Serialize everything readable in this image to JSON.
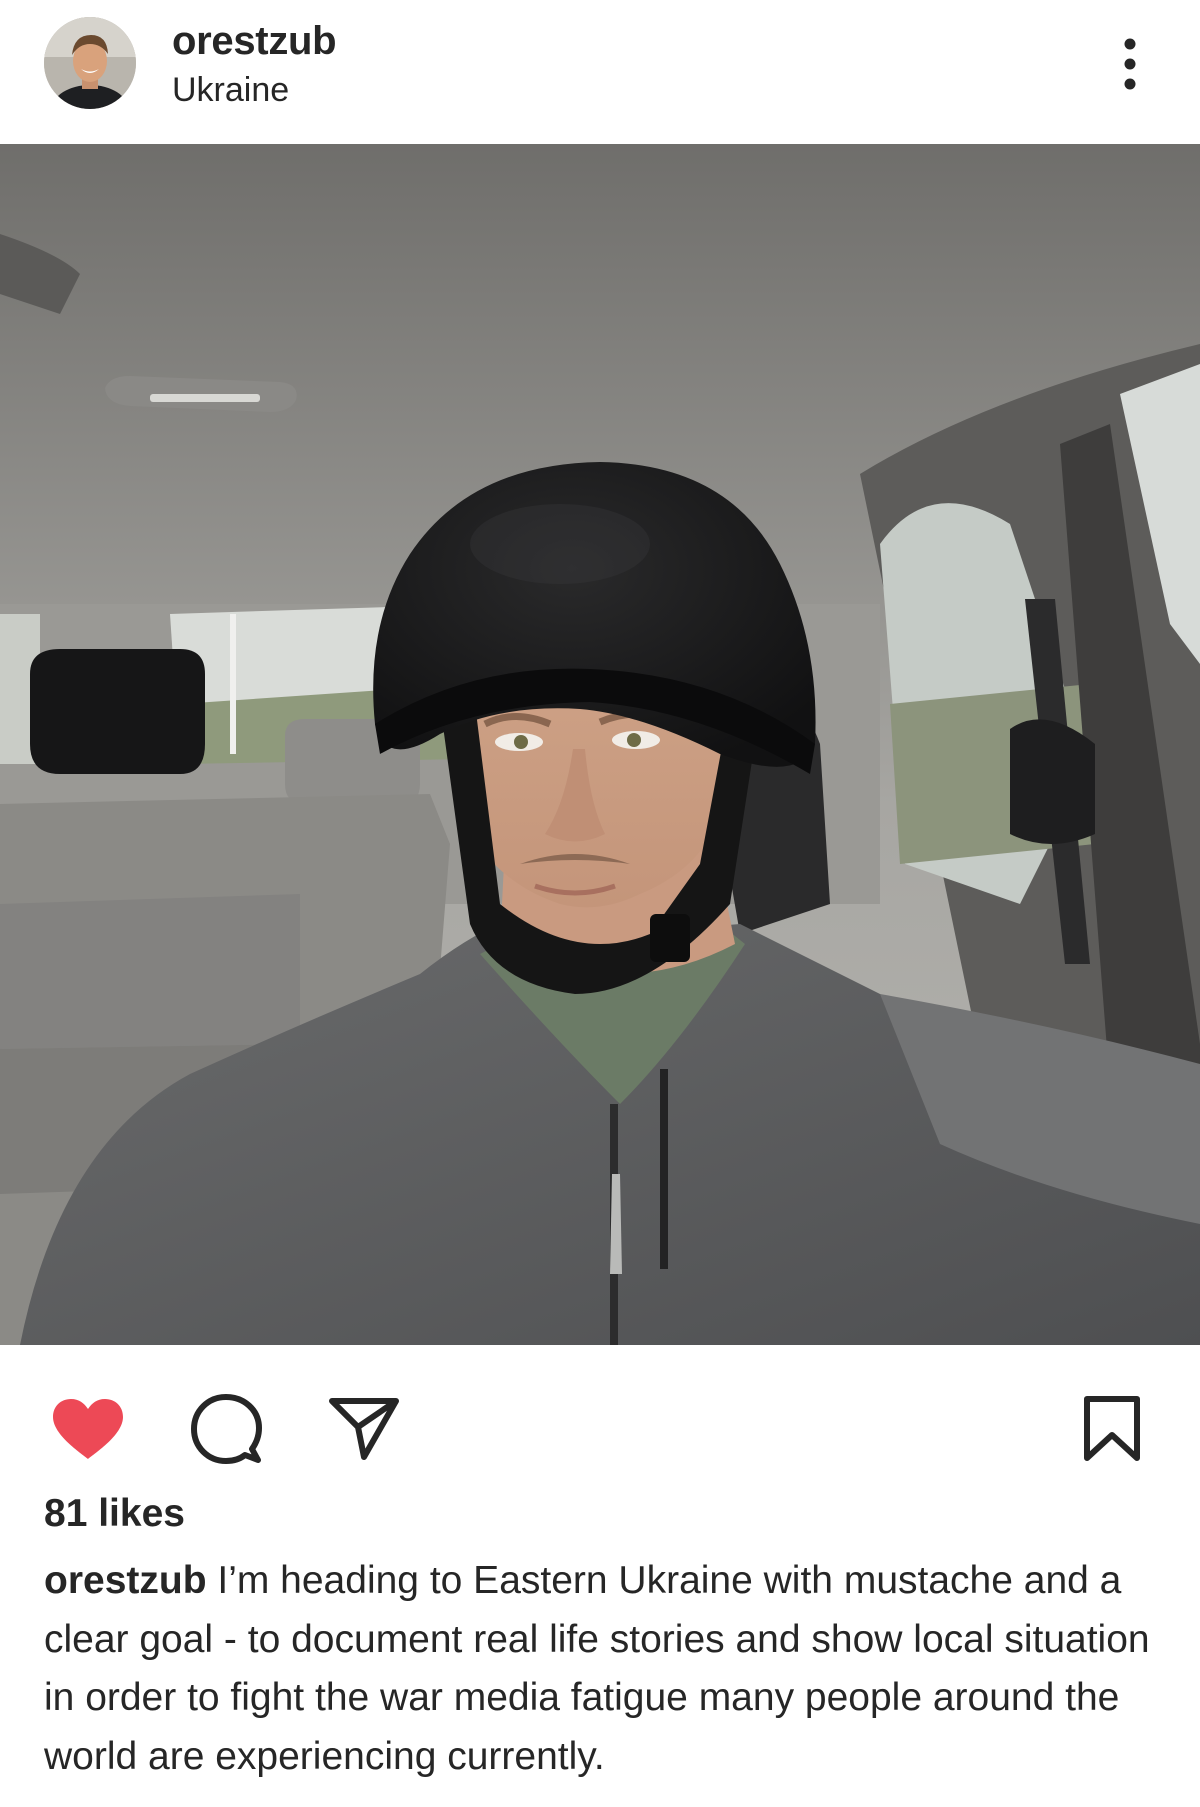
{
  "post": {
    "author": {
      "username": "orestzub",
      "location": "Ukraine"
    },
    "icons": {
      "more": "more-vertical-icon",
      "like": "heart-filled-icon",
      "comment": "comment-bubble-icon",
      "share": "send-paper-plane-icon",
      "save": "bookmark-outline-icon"
    },
    "liked": true,
    "likes_label": "81 likes",
    "caption": {
      "username": "orestzub",
      "text": "I’m heading to Eastern Ukraine with mustache and a clear goal - to document real life stories and show local situation in order to fight the war media fatigue many people around the world are experiencing currently."
    },
    "colors": {
      "like_active": "#ED4956",
      "text": "#262626"
    }
  }
}
